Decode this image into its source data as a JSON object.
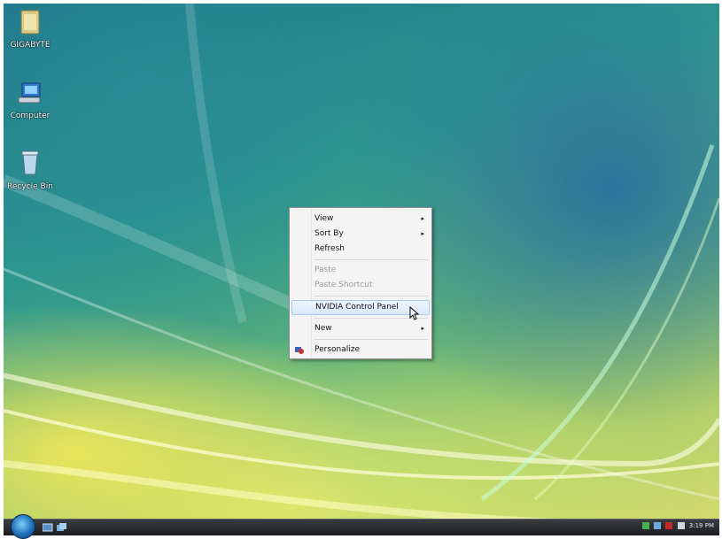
{
  "desktop": {
    "icons": [
      {
        "label": "GIGABYTE",
        "icon": "folder-icon"
      },
      {
        "label": "Computer",
        "icon": "computer-icon"
      },
      {
        "label": "Recycle Bin",
        "icon": "recycle-bin-icon"
      }
    ]
  },
  "context_menu": {
    "items": [
      {
        "label": "View",
        "submenu": true
      },
      {
        "label": "Sort By",
        "submenu": true
      },
      {
        "label": "Refresh"
      },
      {
        "label": "Paste",
        "disabled": true
      },
      {
        "label": "Paste Shortcut",
        "disabled": true
      },
      {
        "label": "NVIDIA Control Panel",
        "highlighted": true
      },
      {
        "label": "New",
        "submenu": true
      },
      {
        "label": "Personalize",
        "icon": "personalize-icon"
      }
    ],
    "submenu_arrow": "▸"
  },
  "taskbar": {
    "clock": "3:19 PM",
    "start_icon": "windows-start-orb-icon",
    "quick_launch": [
      "show-desktop-icon",
      "switch-windows-icon"
    ]
  },
  "colors": {
    "menu_bg": "#f4f4f4",
    "highlight": "#d9e9fb",
    "taskbar": "#1a1c1f"
  }
}
